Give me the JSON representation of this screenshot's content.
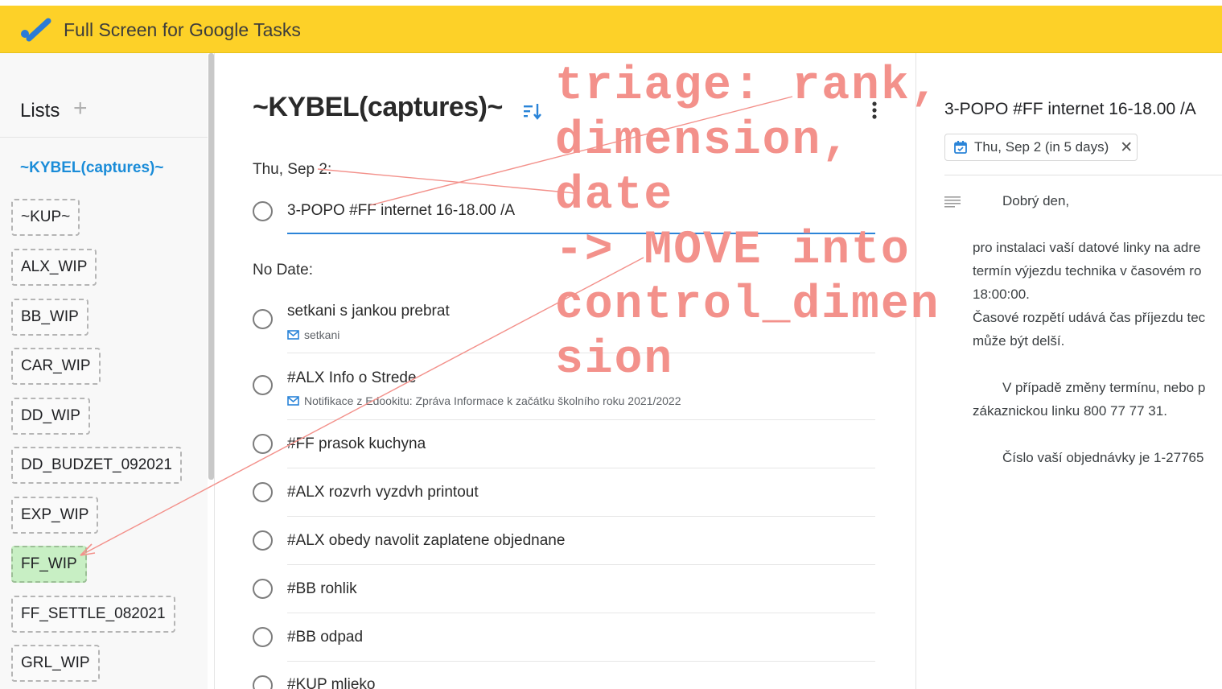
{
  "app": {
    "title": "Full Screen for Google Tasks"
  },
  "sidebar": {
    "title": "Lists",
    "add_label": "+",
    "active_list": "~KYBEL(captures)~",
    "lists": [
      "~KUP~",
      "ALX_WIP",
      "BB_WIP",
      "CAR_WIP",
      "DD_WIP",
      "DD_BUDZET_092021",
      "EXP_WIP",
      "FF_WIP",
      "FF_SETTLE_082021",
      "GRL_WIP"
    ],
    "highlighted": "FF_WIP",
    "highlight_color": "#c8efc4"
  },
  "main": {
    "title": "~KYBEL(captures)~",
    "sections": [
      {
        "label": "Thu, Sep 2:"
      },
      {
        "label": "No Date:"
      }
    ],
    "dated_tasks": [
      {
        "title": "3-POPO #FF internet 16-18.00 /A"
      }
    ],
    "tasks": [
      {
        "title": "setkani s jankou prebrat",
        "sub": "setkani",
        "sub_icon": "mail-icon"
      },
      {
        "title": "#ALX Info o Strede",
        "sub": "Notifikace z Edookitu: Zpráva Informace k začátku školního roku 2021/2022",
        "sub_icon": "mail-icon"
      },
      {
        "title": "#FF prasok kuchyna"
      },
      {
        "title": "#ALX rozvrh vyzdvh printout"
      },
      {
        "title": "#ALX obedy navolit zaplatene objednane"
      },
      {
        "title": "#BB rohlik"
      },
      {
        "title": "#BB odpad"
      },
      {
        "title": "#KUP mlieko"
      }
    ]
  },
  "detail": {
    "title": "3-POPO #FF internet 16-18.00 /A",
    "date_chip": "Thu, Sep 2 (in 5 days)",
    "date_close": "✕",
    "notes": [
      "Dobrý den,",
      "pro instalaci vaší datové linky na adre",
      "termín výjezdu technika v časovém ro",
      "18:00:00.",
      "Časové rozpětí udává čas příjezdu tec",
      "může být delší.",
      "V případě změny termínu, nebo p",
      "zákaznickou linku 800 77 77 31.",
      "Číslo vaší objednávky je 1-27765"
    ]
  },
  "annotation": {
    "lines": [
      "triage: rank,",
      "dimension,",
      "date",
      "-> MOVE into",
      "control_dimen",
      "sion"
    ],
    "color": "#f3918b"
  },
  "colors": {
    "appbar": "#fdd128",
    "accent_blue": "#1a8cd8"
  }
}
